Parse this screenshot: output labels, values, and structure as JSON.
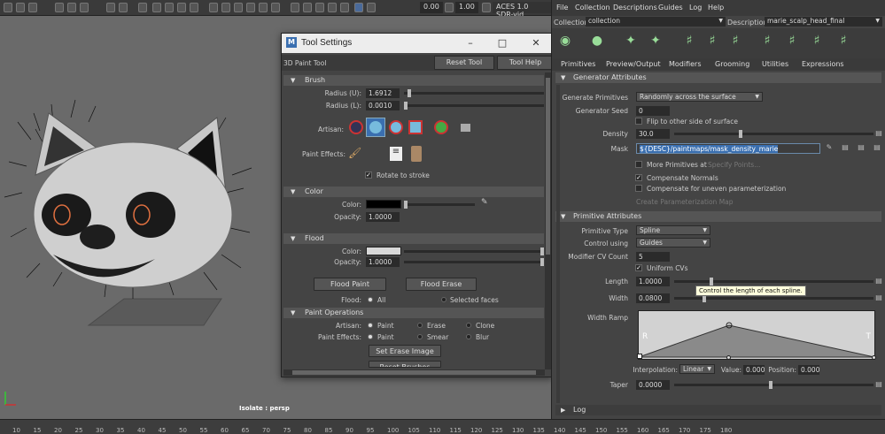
{
  "viewport": {
    "toolbar": {
      "value_a": "0.00",
      "value_b": "1.00",
      "colorspace": "ACES 1.0 SDR-vid"
    },
    "camera_label": "Isolate : persp"
  },
  "timeline": {
    "ticks": [
      "10",
      "15",
      "20",
      "25",
      "30",
      "35",
      "40",
      "45",
      "50",
      "55",
      "60",
      "65",
      "70",
      "75",
      "80",
      "85",
      "90",
      "95",
      "100",
      "105",
      "110",
      "115",
      "120",
      "125",
      "130",
      "135",
      "140",
      "145",
      "150",
      "155",
      "160",
      "165",
      "170",
      "175",
      "180"
    ]
  },
  "tool_settings": {
    "title": "Tool Settings",
    "tool_name": "3D Paint Tool",
    "reset_label": "Reset Tool",
    "help_label": "Tool Help",
    "brush": {
      "section": "Brush",
      "radius_u_label": "Radius (U):",
      "radius_u_value": "1.6912",
      "radius_l_label": "Radius (L):",
      "radius_l_value": "0.0010",
      "artisan_label": "Artisan:",
      "paint_effects_label": "Paint Effects:",
      "rotate_label": "Rotate to stroke",
      "rotate_checked": true
    },
    "color": {
      "section": "Color",
      "color_label": "Color:",
      "color_value": "#000000",
      "opacity_label": "Opacity:",
      "opacity_value": "1.0000"
    },
    "flood": {
      "section": "Flood",
      "color_label": "Color:",
      "color_value": "#d8d8d8",
      "opacity_label": "Opacity:",
      "opacity_value": "1.0000",
      "flood_paint": "Flood Paint",
      "flood_erase": "Flood Erase",
      "flood_label": "Flood:",
      "opt_all": "All",
      "opt_selected": "Selected faces"
    },
    "paint_ops": {
      "section": "Paint Operations",
      "artisan_label": "Artisan:",
      "paint_effects_label": "Paint Effects:",
      "artisan_opts": [
        "Paint",
        "Erase",
        "Clone"
      ],
      "pe_opts": [
        "Paint",
        "Smear",
        "Blur"
      ],
      "set_erase": "Set Erase Image",
      "reset_brushes": "Reset Brushes"
    }
  },
  "attr_editor": {
    "menus": [
      "File",
      "Collection",
      "Descriptions",
      "Guides",
      "Log",
      "Help"
    ],
    "collection_label": "Collection",
    "collection_value": "collection",
    "description_label": "Description",
    "description_value": "marie_scalp_head_final",
    "tabs": [
      "Primitives",
      "Preview/Output",
      "Modifiers",
      "Grooming",
      "Utilities",
      "Expressions"
    ],
    "generator": {
      "section": "Generator Attributes",
      "gen_prims_label": "Generate Primitives",
      "gen_prims_value": "Randomly across the surface",
      "seed_label": "Generator Seed",
      "seed_value": "0",
      "flip_label": "Flip to other side of surface",
      "density_label": "Density",
      "density_value": "30.0",
      "mask_label": "Mask",
      "mask_value": "${DESC}/paintmaps/mask_density_marie",
      "more_prims_label": "More Primitives at",
      "specify_points": "Specify Points...",
      "compensate_normals": "Compensate Normals",
      "compensate_uneven": "Compensate for uneven parameterization",
      "create_param_map": "Create Parameterization Map"
    },
    "primitive": {
      "section": "Primitive Attributes",
      "type_label": "Primitive Type",
      "type_value": "Spline",
      "control_label": "Control using",
      "control_value": "Guides",
      "cv_label": "Modifier CV Count",
      "cv_value": "5",
      "uniform_cvs": "Uniform CVs",
      "length_label": "Length",
      "length_value": "1.0000",
      "width_label": "Width",
      "width_value": "0.0800",
      "tooltip": "Control the length of each spline.",
      "ramp_label": "Width Ramp",
      "ramp_r": "R",
      "ramp_t": "T",
      "interp_label": "Interpolation:",
      "interp_value": "Linear",
      "value_label": "Value:",
      "value_value": "0.000",
      "position_label": "Position:",
      "position_value": "0.000",
      "taper_label": "Taper",
      "taper_value": "0.0000"
    },
    "log_section": "Log"
  }
}
